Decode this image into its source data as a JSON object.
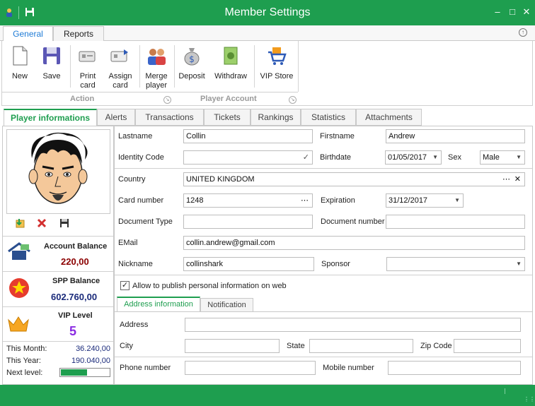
{
  "window": {
    "title": "Member Settings"
  },
  "ribbon_tabs": [
    {
      "label": "General"
    },
    {
      "label": "Reports"
    }
  ],
  "ribbon": {
    "new": "New",
    "save": "Save",
    "print_card": "Print\ncard",
    "assign_card": "Assign\ncard",
    "merge_player": "Merge\nplayer",
    "deposit": "Deposit",
    "withdraw": "Withdraw",
    "vip_store": "VIP Store",
    "group_action": "Action",
    "group_player_account": "Player Account"
  },
  "player_tabs": [
    {
      "label": "Player informations"
    },
    {
      "label": "Alerts"
    },
    {
      "label": "Transactions"
    },
    {
      "label": "Tickets"
    },
    {
      "label": "Rankings"
    },
    {
      "label": "Statistics"
    },
    {
      "label": "Attachments"
    }
  ],
  "left": {
    "account_balance_label": "Account Balance",
    "account_balance_value": "220,00",
    "spp_balance_label": "SPP Balance",
    "spp_balance_value": "602.760,00",
    "vip_level_label": "VIP Level",
    "vip_level_value": "5",
    "this_month_label": "This Month:",
    "this_month_value": "36.240,00",
    "this_year_label": "This Year:",
    "this_year_value": "190.040,00",
    "next_level_label": "Next level:",
    "next_level_progress": 0.55
  },
  "form": {
    "lastname_label": "Lastname",
    "lastname_value": "Collin",
    "firstname_label": "Firstname",
    "firstname_value": "Andrew",
    "identity_code_label": "Identity Code",
    "identity_code_value": "",
    "birthdate_label": "Birthdate",
    "birthdate_value": "01/05/2017",
    "sex_label": "Sex",
    "sex_value": "Male",
    "country_label": "Country",
    "country_value": "UNITED KINGDOM",
    "card_number_label": "Card number",
    "card_number_value": "1248",
    "expiration_label": "Expiration",
    "expiration_value": "31/12/2017",
    "document_type_label": "Document Type",
    "document_type_value": "",
    "document_number_label": "Document number",
    "document_number_value": "",
    "email_label": "EMail",
    "email_value": "collin.andrew@gmail.com",
    "nickname_label": "Nickname",
    "nickname_value": "collinshark",
    "sponsor_label": "Sponsor",
    "sponsor_value": "",
    "publish_label": "Allow to publish personal information on web",
    "publish_checked": true
  },
  "address_tabs": [
    {
      "label": "Address information"
    },
    {
      "label": "Notification"
    }
  ],
  "address": {
    "address_label": "Address",
    "address_value": "",
    "city_label": "City",
    "city_value": "",
    "state_label": "State",
    "state_value": "",
    "zip_label": "Zip Code",
    "zip_value": "",
    "phone_label": "Phone number",
    "phone_value": "",
    "mobile_label": "Mobile number",
    "mobile_value": ""
  },
  "colors": {
    "accent": "#1e9e4f",
    "balance_red": "#8b0000",
    "spp_blue": "#1a2a7a",
    "vip_purple": "#8a2be2"
  }
}
